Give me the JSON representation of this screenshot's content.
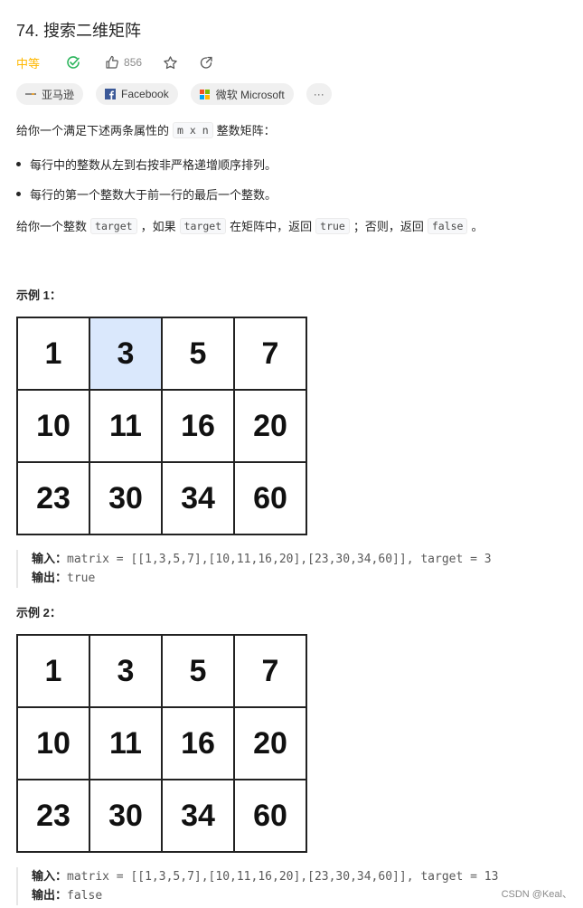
{
  "problem": {
    "title": "74. 搜索二维矩阵",
    "difficulty": "中等",
    "likes": "856",
    "colors": {
      "difficulty": "#ffb800",
      "solved": "#2db55d",
      "highlight": "#dae8fc"
    }
  },
  "tags": [
    {
      "label": "亚马逊",
      "icon": "amazon-icon"
    },
    {
      "label": "Facebook",
      "icon": "facebook-icon"
    },
    {
      "label": "微软 Microsoft",
      "icon": "microsoft-icon"
    },
    {
      "label": "···",
      "icon": "more-icon"
    }
  ],
  "description": {
    "intro_before": "给你一个满足下述两条属性的",
    "intro_code": "m x n",
    "intro_after": "整数矩阵：",
    "bullets": [
      "每行中的整数从左到右按非严格递增顺序排列。",
      "每行的第一个整数大于前一行的最后一个整数。"
    ],
    "task": {
      "t1": "给你一个整数",
      "c1": "target",
      "t2": "，如果",
      "c2": "target",
      "t3": "在矩阵中，返回",
      "c3": "true",
      "t4": "；否则，返回",
      "c4": "false",
      "t5": "。"
    }
  },
  "examples": [
    {
      "title": "示例 1：",
      "matrix": [
        [
          1,
          3,
          5,
          7
        ],
        [
          10,
          11,
          16,
          20
        ],
        [
          23,
          30,
          34,
          60
        ]
      ],
      "highlight": [
        0,
        1
      ],
      "input_label": "输入：",
      "input": "matrix = [[1,3,5,7],[10,11,16,20],[23,30,34,60]], target = 3",
      "output_label": "输出：",
      "output": "true"
    },
    {
      "title": "示例 2：",
      "matrix": [
        [
          1,
          3,
          5,
          7
        ],
        [
          10,
          11,
          16,
          20
        ],
        [
          23,
          30,
          34,
          60
        ]
      ],
      "highlight": null,
      "input_label": "输入：",
      "input": "matrix = [[1,3,5,7],[10,11,16,20],[23,30,34,60]], target = 13",
      "output_label": "输出：",
      "output": "false"
    }
  ],
  "watermark": "CSDN @Keal、"
}
